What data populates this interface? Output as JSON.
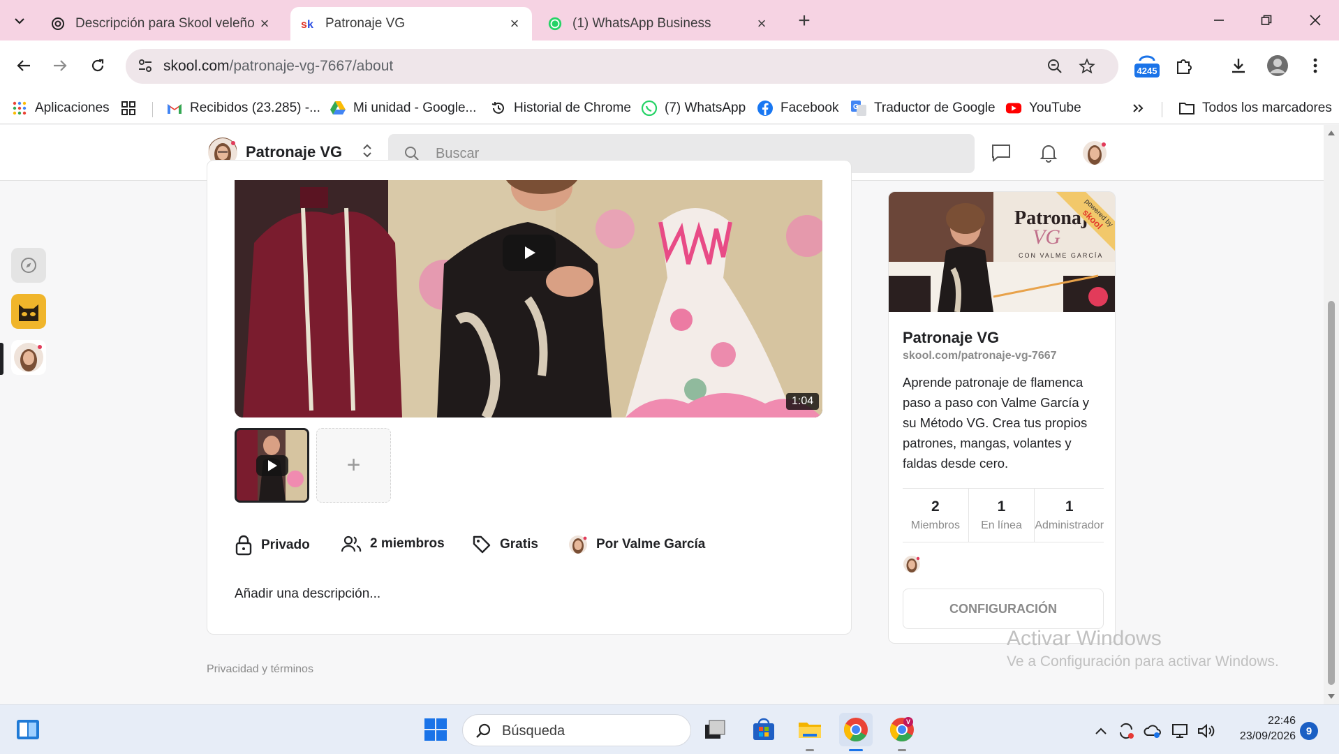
{
  "browser": {
    "tabs": [
      {
        "title": "Descripción para Skool veleño",
        "icon": "chatgpt-icon",
        "active": false
      },
      {
        "title": "Patronaje VG",
        "icon": "skool-icon",
        "active": true
      },
      {
        "title": "(1) WhatsApp Business",
        "icon": "whatsapp-icon",
        "active": false
      }
    ],
    "address": {
      "domain": "skool.com",
      "path": "/patronaje-vg-7667/about"
    },
    "extension_badge": "4245",
    "bookmarks": [
      {
        "label": "Aplicaciones",
        "icon": "apps-grid-icon"
      },
      {
        "label": "Recibidos (23.285) -...",
        "icon": "gmail-icon"
      },
      {
        "label": "Mi unidad - Google...",
        "icon": "google-drive-icon"
      },
      {
        "label": "Historial de Chrome",
        "icon": "history-icon"
      },
      {
        "label": "(7) WhatsApp",
        "icon": "whatsapp-icon"
      },
      {
        "label": "Facebook",
        "icon": "facebook-icon"
      },
      {
        "label": "Traductor de Google",
        "icon": "google-translate-icon"
      },
      {
        "label": "YouTube",
        "icon": "youtube-icon"
      }
    ],
    "all_bookmarks": "Todos los marcadores"
  },
  "skool": {
    "group_name": "Patronaje VG",
    "search_placeholder": "Buscar",
    "video": {
      "duration": "1:04"
    },
    "meta": {
      "privacy": "Privado",
      "members": "2 miembros",
      "price": "Gratis",
      "owner": "Por Valme García"
    },
    "add_description": "Añadir una descripción...",
    "footer_link": "Privacidad y términos",
    "about": {
      "title": "Patronaje VG",
      "url": "skool.com/patronaje-vg-7667",
      "description": "Aprende patronaje de flamenca paso a paso con Valme García y su Método VG. Crea tus propios patrones, mangas, volantes y faldas desde cero.",
      "cover_brand": "Patronaje",
      "cover_sub": "VG",
      "cover_tagline": "CON VALME GARCÍA",
      "ribbon_powered": "powered by",
      "ribbon_brand": "skool",
      "stats": [
        {
          "value": "2",
          "label": "Miembros"
        },
        {
          "value": "1",
          "label": "En línea"
        },
        {
          "value": "1",
          "label": "Administrador"
        }
      ],
      "settings_button": "CONFIGURACIÓN"
    }
  },
  "windows": {
    "watermark_title": "Activar Windows",
    "watermark_sub": "Ve a Configuración para activar Windows.",
    "taskbar_search": "Búsqueda",
    "time": "22:46",
    "date": "23/09/2026",
    "notifications": "9"
  },
  "colors": {
    "tabstrip": "#f6d3e3",
    "omnibox": "#efe6ea",
    "taskbar": "#e7edf7"
  }
}
